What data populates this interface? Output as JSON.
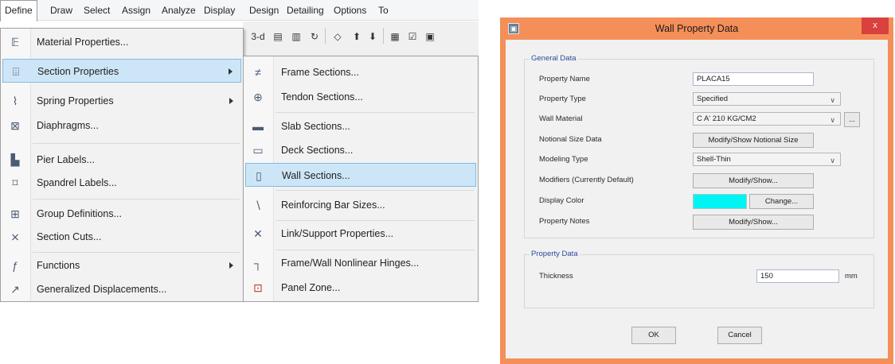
{
  "menubar": {
    "items": [
      "Define",
      "Draw",
      "Select",
      "Assign",
      "Analyze",
      "Display",
      "Design",
      "Detailing",
      "Options",
      "To"
    ]
  },
  "toolbar": {
    "view_3d": "3-d"
  },
  "define_menu": {
    "items": [
      {
        "label": "Material Properties...",
        "icon": "material-icon",
        "submenu": false
      },
      {
        "label": "Section Properties",
        "icon": "section-icon",
        "submenu": true
      },
      {
        "label": "Spring Properties",
        "icon": "spring-icon",
        "submenu": true
      },
      {
        "label": "Diaphragms...",
        "icon": "diaphragm-icon",
        "submenu": false
      },
      {
        "label": "Pier Labels...",
        "icon": "pier-icon",
        "submenu": false
      },
      {
        "label": "Spandrel Labels...",
        "icon": "spandrel-icon",
        "submenu": false
      },
      {
        "label": "Group Definitions...",
        "icon": "group-icon",
        "submenu": false
      },
      {
        "label": "Section Cuts...",
        "icon": "section-cut-icon",
        "submenu": false
      },
      {
        "label": "Functions",
        "icon": "function-icon",
        "submenu": true
      },
      {
        "label": "Generalized Displacements...",
        "icon": "displacement-icon",
        "submenu": false
      }
    ]
  },
  "section_menu": {
    "items": [
      {
        "label": "Frame Sections...",
        "icon": "frame-section-icon"
      },
      {
        "label": "Tendon Sections...",
        "icon": "tendon-section-icon"
      },
      {
        "label": "Slab Sections...",
        "icon": "slab-section-icon"
      },
      {
        "label": "Deck Sections...",
        "icon": "deck-section-icon"
      },
      {
        "label": "Wall Sections...",
        "icon": "wall-section-icon"
      },
      {
        "label": "Reinforcing Bar Sizes...",
        "icon": "rebar-icon"
      },
      {
        "label": "Link/Support Properties...",
        "icon": "link-support-icon"
      },
      {
        "label": "Frame/Wall Nonlinear Hinges...",
        "icon": "hinge-icon"
      },
      {
        "label": "Panel Zone...",
        "icon": "panel-zone-icon"
      }
    ]
  },
  "dialog": {
    "title": "Wall Property Data",
    "close": "x",
    "general": {
      "title": "General Data",
      "property_name_label": "Property Name",
      "property_name_value": "PLACA15",
      "property_type_label": "Property Type",
      "property_type_value": "Specified",
      "wall_material_label": "Wall Material",
      "wall_material_value": "C A' 210 KG/CM2",
      "wall_material_more": "...",
      "notional_size_label": "Notional Size Data",
      "notional_size_button": "Modify/Show Notional Size",
      "modeling_type_label": "Modeling Type",
      "modeling_type_value": "Shell-Thin",
      "modifiers_label": "Modifiers (Currently Default)",
      "modifiers_button": "Modify/Show...",
      "display_color_label": "Display Color",
      "display_color_value": "#00f4f4",
      "change_button": "Change...",
      "notes_label": "Property Notes",
      "notes_button": "Modify/Show..."
    },
    "property": {
      "title": "Property Data",
      "thickness_label": "Thickness",
      "thickness_value": "150",
      "thickness_unit": "mm"
    },
    "ok": "OK",
    "cancel": "Cancel"
  }
}
